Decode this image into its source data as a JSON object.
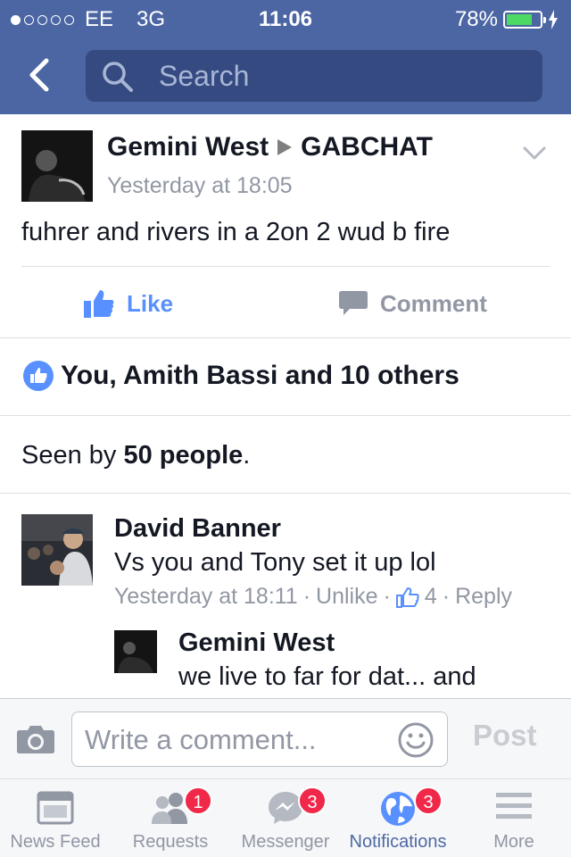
{
  "status_bar": {
    "carrier": "EE",
    "network": "3G",
    "time": "11:06",
    "battery": "78%",
    "battery_level": 0.78
  },
  "nav": {
    "search_placeholder": "Search"
  },
  "post": {
    "author": "Gemini West",
    "target": "GABCHAT",
    "time": "Yesterday at 18:05",
    "text": "fuhrer and rivers in a 2on 2 wud b fire",
    "like_label": "Like",
    "comment_label": "Comment",
    "likes_summary": "You, Amith Bassi and 10 others",
    "seen_prefix": "Seen by ",
    "seen_count": "50 people",
    "seen_suffix": "."
  },
  "comments": [
    {
      "author": "David Banner",
      "text": "Vs you and Tony set it up lol",
      "time": "Yesterday at 18:11",
      "sep1": "·",
      "action": "Unlike",
      "sep2": "·",
      "like_count": "4",
      "sep3": "·",
      "reply": "Reply",
      "replies": [
        {
          "author": "Gemini West",
          "text": "we live to far for dat... and"
        }
      ]
    }
  ],
  "composer": {
    "placeholder": "Write a comment...",
    "post_label": "Post"
  },
  "tabs": [
    {
      "label": "News Feed",
      "icon": "news-feed-icon",
      "badge": ""
    },
    {
      "label": "Requests",
      "icon": "friend-requests-icon",
      "badge": "1"
    },
    {
      "label": "Messenger",
      "icon": "messenger-icon",
      "badge": "3"
    },
    {
      "label": "Notifications",
      "icon": "globe-icon",
      "badge": "3"
    },
    {
      "label": "More",
      "icon": "menu-icon",
      "badge": ""
    }
  ],
  "colors": {
    "brand": "#4c66a4",
    "link": "#5890ff",
    "badge": "#f02849",
    "battery": "#4cd964"
  }
}
